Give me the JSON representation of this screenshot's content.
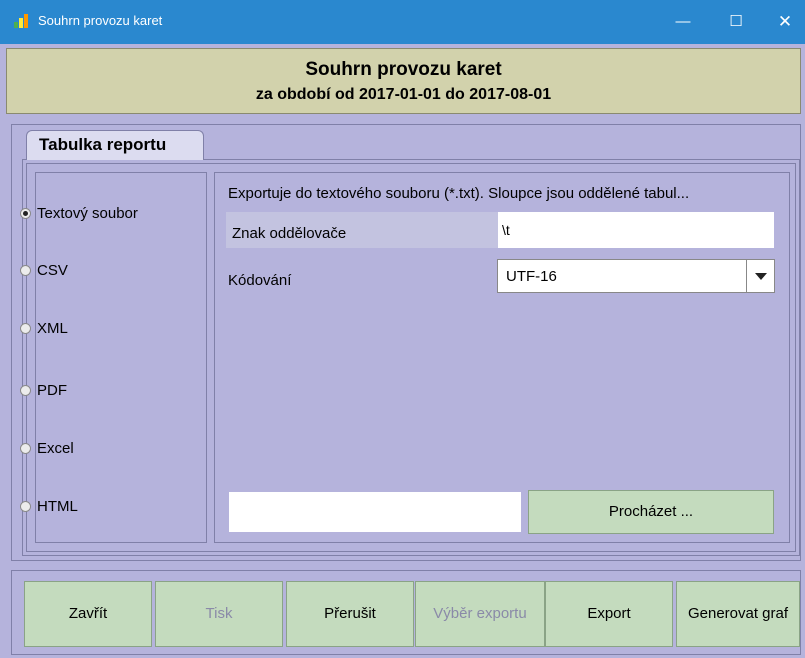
{
  "window": {
    "title": "Souhrn provozu karet",
    "min": "—",
    "max": "☐",
    "close": "✕"
  },
  "header": {
    "title": "Souhrn provozu karet",
    "period": "za období od 2017-01-01 do 2017-08-01"
  },
  "tab": {
    "label": "Tabulka reportu"
  },
  "formats": [
    {
      "label": "Textový soubor",
      "selected": true
    },
    {
      "label": "CSV",
      "selected": false
    },
    {
      "label": "XML",
      "selected": false
    },
    {
      "label": "PDF",
      "selected": false
    },
    {
      "label": "Excel",
      "selected": false
    },
    {
      "label": "HTML",
      "selected": false
    }
  ],
  "options": {
    "description": "Exportuje do textového souboru (*.txt). Sloupce jsou oddělené tabul...",
    "separator_label": "Znak oddělovače",
    "separator_value": "\\t",
    "encoding_label": "Kódování",
    "encoding_value": "UTF-16",
    "path_value": "",
    "browse_label": "Procházet ..."
  },
  "footer": {
    "close": "Zavřít",
    "print": "Tisk",
    "abort": "Přerušit",
    "export_select": "Výběr exportu",
    "export": "Export",
    "chart": "Generovat graf"
  },
  "colors": {
    "titlebar": "#2a88cf",
    "header": "#d2d2ac",
    "panel": "#b5b3dc",
    "button": "#c4dbbe"
  }
}
